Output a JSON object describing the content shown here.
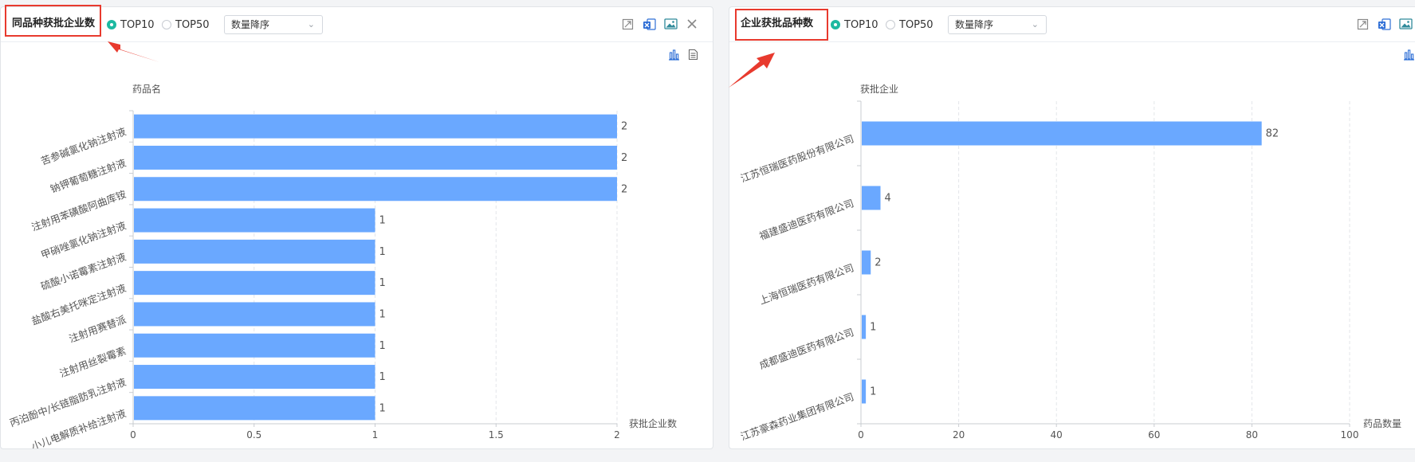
{
  "panels": [
    {
      "title": "同品种获批企业数",
      "radio_top10": "TOP10",
      "radio_top50": "TOP50",
      "selected": "TOP10",
      "sort_value": "数量降序",
      "colors": {
        "bar": "#6aa8ff",
        "accent": "#1db9a1",
        "highlight": "#e83a2e"
      },
      "icons": [
        "fullscreen-icon",
        "excel-export-icon",
        "image-export-icon",
        "close-icon",
        "bar-chart-icon",
        "document-icon"
      ]
    },
    {
      "title": "企业获批品种数",
      "radio_top10": "TOP10",
      "radio_top50": "TOP50",
      "selected": "TOP10",
      "sort_value": "数量降序",
      "colors": {
        "bar": "#6aa8ff",
        "accent": "#1db9a1",
        "highlight": "#e83a2e"
      },
      "icons": [
        "fullscreen-icon",
        "excel-export-icon",
        "image-export-icon",
        "bar-chart-icon"
      ]
    }
  ],
  "chart_data": [
    {
      "type": "bar",
      "orientation": "horizontal",
      "categories": [
        "苦参碱氯化钠注射液",
        "钠钾葡萄糖注射液",
        "注射用苯磺酸阿曲库铵",
        "甲硝唑氯化钠注射液",
        "硫酸小诺霉素注射液",
        "盐酸右美托咪定注射液",
        "注射用赛替派",
        "注射用丝裂霉素",
        "丙泊酚中/长链脂肪乳注射液",
        "小儿电解质补给注射液"
      ],
      "values": [
        2,
        2,
        2,
        1,
        1,
        1,
        1,
        1,
        1,
        1
      ],
      "xlabel": "获批企业数",
      "ylabel": "药品名",
      "xlim": [
        0,
        2
      ],
      "xticks": [
        "0",
        "0.5",
        "1",
        "1.5",
        "2"
      ],
      "grid": true
    },
    {
      "type": "bar",
      "orientation": "horizontal",
      "categories": [
        "江苏恒瑞医药股份有限公司",
        "福建盛迪医药有限公司",
        "上海恒瑞医药有限公司",
        "成都盛迪医药有限公司",
        "江苏豪森药业集团有限公司"
      ],
      "values": [
        82,
        4,
        2,
        1,
        1
      ],
      "xlabel": "药品数量",
      "ylabel": "获批企业",
      "xlim": [
        0,
        100
      ],
      "xticks": [
        "0",
        "20",
        "40",
        "60",
        "80",
        "100"
      ],
      "grid": true
    }
  ]
}
